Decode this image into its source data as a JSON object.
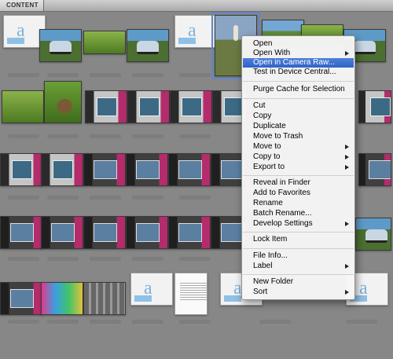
{
  "panel": {
    "tab_label": "CONTENT"
  },
  "thumbnails": {
    "row1": [
      "doc",
      "car",
      "grass",
      "car",
      "doc",
      "person",
      "sky",
      "grass",
      "car"
    ],
    "row2": [
      "grass",
      "bunny",
      "ps",
      "ps",
      "ps",
      "ps",
      "ps"
    ],
    "row3": [
      "ps",
      "ps",
      "ps",
      "ps-dark",
      "ps-dark",
      "ps-dark",
      "ps-dark"
    ],
    "row4": [
      "ps-dark",
      "ps-dark",
      "ps-dark",
      "ps-dark",
      "ps-dark",
      "ps-dark",
      "ps-dark",
      "car"
    ],
    "row5": [
      "ps-dark",
      "colour",
      "screen",
      "doc",
      "page",
      "doc",
      "doc"
    ]
  },
  "context_menu": {
    "items": [
      {
        "label": "Open"
      },
      {
        "label": "Open With"
      },
      {
        "label": "Open in Camera Raw...",
        "highlighted": true
      },
      {
        "label": "Test in Device Central..."
      },
      {
        "label": "Purge Cache for Selection"
      },
      {
        "label": "Cut"
      },
      {
        "label": "Copy"
      },
      {
        "label": "Duplicate"
      },
      {
        "label": "Move to Trash"
      },
      {
        "label": "Move to"
      },
      {
        "label": "Copy to"
      },
      {
        "label": "Export to"
      },
      {
        "label": "Reveal in Finder"
      },
      {
        "label": "Add to Favorites"
      },
      {
        "label": "Rename"
      },
      {
        "label": "Batch Rename..."
      },
      {
        "label": "Develop Settings"
      },
      {
        "label": "Lock Item"
      },
      {
        "label": "File Info..."
      },
      {
        "label": "Label"
      },
      {
        "label": "New Folder"
      },
      {
        "label": "Sort"
      }
    ],
    "highlight_color": "#3a6fd0"
  }
}
